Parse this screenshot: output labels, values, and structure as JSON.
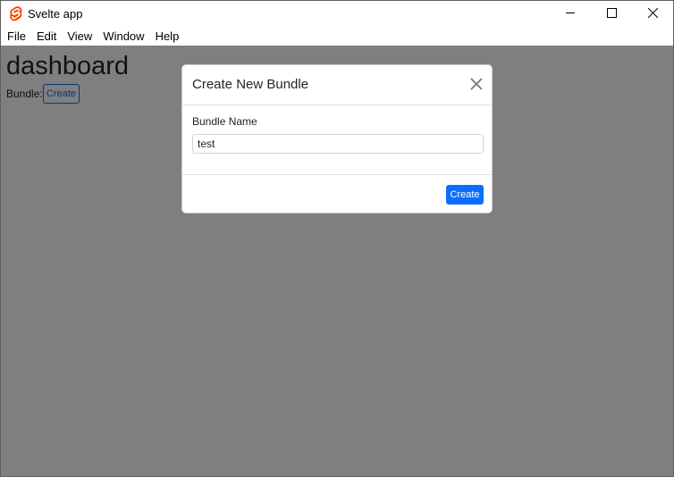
{
  "window": {
    "title": "Svelte app",
    "app_icon": "svelte-icon",
    "controls": [
      "minimize-icon",
      "maximize-icon",
      "close-icon"
    ]
  },
  "menu": {
    "items": [
      "File",
      "Edit",
      "View",
      "Window",
      "Help"
    ]
  },
  "page": {
    "title": "dashboard",
    "bundle_label": "Bundle:",
    "create_label": "Create"
  },
  "modal": {
    "title": "Create New Bundle",
    "field_label": "Bundle Name",
    "field_value": "test",
    "submit_label": "Create",
    "close_icon": "close-icon"
  },
  "colors": {
    "accent": "#0d6efd",
    "backdrop": "#808080",
    "svelte_orange": "#ff3e00"
  }
}
